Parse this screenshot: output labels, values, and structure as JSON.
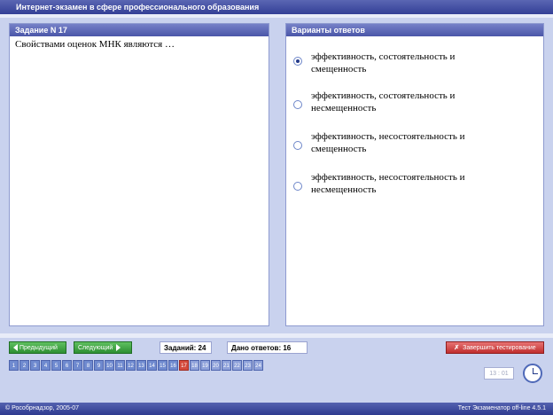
{
  "window": {
    "title": "Интернет-экзамен в сфере профессионального образования"
  },
  "question_panel": {
    "header": "Задание N 17",
    "text": "Свойствами оценок МНК являются …"
  },
  "answers_panel": {
    "header": "Варианты ответов",
    "options": [
      {
        "label": "эффективность, состоятельность и смещенность",
        "selected": true
      },
      {
        "label": "эффективность, состоятельность и несмещенность",
        "selected": false
      },
      {
        "label": "эффективность, несостоятельность и смещенность",
        "selected": false
      },
      {
        "label": "эффективность, несостоятельность и несмещенность",
        "selected": false
      }
    ]
  },
  "nav": {
    "prev_label": "Предыдущий",
    "next_label": "Следующий",
    "tasks_count": "Заданий: 24",
    "answered_count": "Дано ответов: 16",
    "finish_label": "Завершить тестирование"
  },
  "pages": [
    "1",
    "2",
    "3",
    "4",
    "5",
    "6",
    "7",
    "8",
    "9",
    "10",
    "11",
    "12",
    "13",
    "14",
    "15",
    "16",
    "17",
    "18",
    "19",
    "20",
    "21",
    "22",
    "23",
    "24"
  ],
  "current_page": "17",
  "timer": "13 : 01",
  "footer": {
    "copyright": "© Рособрнадзор, 2005-07",
    "version": "Тест Экзаменатор off-line 4.5.1"
  },
  "colors": {
    "title_bar": "#333f96",
    "panel_header": "#4a56a8",
    "nav_button": "#2e8f33",
    "finish_button": "#c02e2e",
    "current_page": "#d44a3c"
  }
}
